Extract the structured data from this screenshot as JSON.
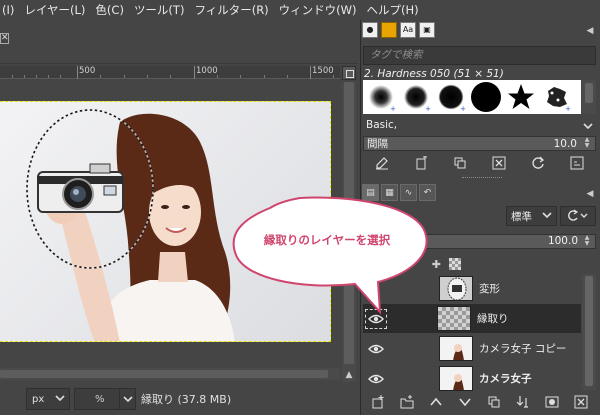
{
  "menubar": {
    "items": [
      "(I)",
      "レイヤー(L)",
      "色(C)",
      "ツール(T)",
      "フィルター(R)",
      "ウィンドウ(W)",
      "ヘルプ(H)"
    ]
  },
  "ruler": {
    "labels": [
      "500",
      "1000",
      "1500"
    ]
  },
  "status": {
    "unit": "px",
    "zoom_unit": "%",
    "layer_info": "縁取り (37.8 MB)"
  },
  "brushes": {
    "tag_placeholder": "タグで検索",
    "current_brush": "2. Hardness 050 (51 × 51)",
    "set_name": "Basic,",
    "spacing_label": "間隔",
    "spacing_value": "10.0"
  },
  "layers": {
    "mode": "標準",
    "opacity_value": "100.0",
    "items": [
      {
        "name": "変形",
        "visible": false,
        "selected": false,
        "bold": false
      },
      {
        "name": "縁取り",
        "visible": true,
        "selected": true,
        "bold": false
      },
      {
        "name": "カメラ女子 コピー",
        "visible": true,
        "selected": false,
        "bold": false
      },
      {
        "name": "カメラ女子",
        "visible": true,
        "selected": false,
        "bold": true
      }
    ]
  },
  "callout": {
    "text": "縁取りのレイヤーを選択",
    "color": "#d0456e"
  },
  "colors": {
    "ui_bg": "#454545",
    "selection_marquee": "#e6e600",
    "selected_row": "#2c2c2c"
  }
}
